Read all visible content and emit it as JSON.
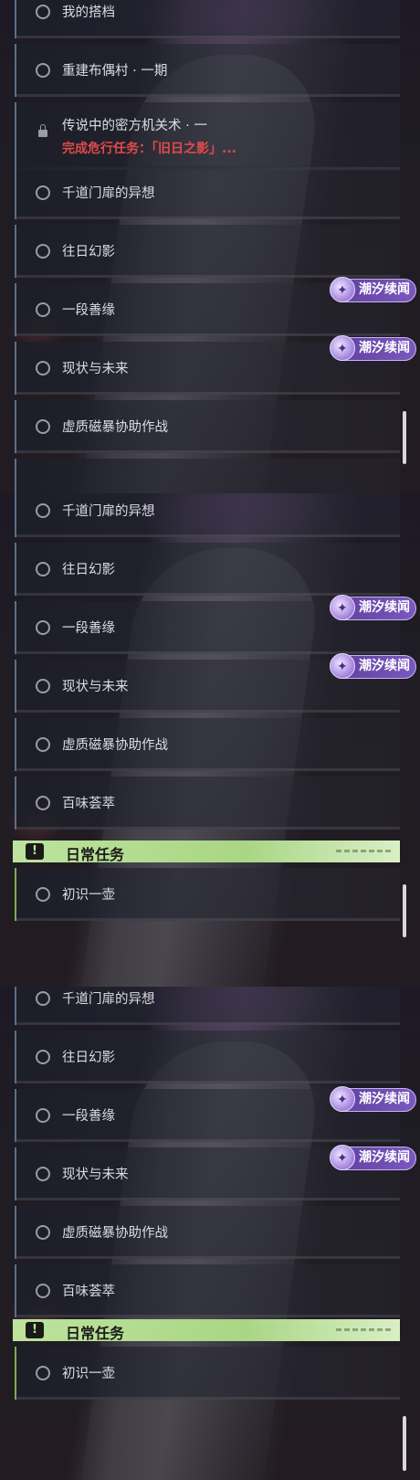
{
  "panel1": {
    "rows": [
      {
        "label": "我的搭档"
      },
      {
        "label": "重建布偶村 · 一期"
      },
      {
        "label": "传说中的密方机关术 · 一",
        "sublabel": "完成危行任务：「旧日之影」..."
      },
      {
        "label": "千道门扉的异想"
      },
      {
        "label": "往日幻影"
      },
      {
        "label": "一段善缘"
      },
      {
        "label": "现状与未来"
      },
      {
        "label": "虚质磁暴协助作战"
      }
    ],
    "badges": [
      "潮汐续闻",
      "潮汐续闻"
    ]
  },
  "panel2": {
    "rows": [
      {
        "label": "千道门扉的异想"
      },
      {
        "label": "往日幻影"
      },
      {
        "label": "一段善缘"
      },
      {
        "label": "现状与未来"
      },
      {
        "label": "虚质磁暴协助作战"
      },
      {
        "label": "百味荟萃"
      }
    ],
    "badges": [
      "潮汐续闻",
      "潮汐续闻"
    ],
    "section_title": "日常任务",
    "section_icon": "!",
    "daily_rows": [
      {
        "label": "初识一壶"
      }
    ]
  },
  "panel3": {
    "rows": [
      {
        "label": "千道门扉的异想"
      },
      {
        "label": "往日幻影"
      },
      {
        "label": "一段善缘"
      },
      {
        "label": "现状与未来"
      },
      {
        "label": "虚质磁暴协助作战"
      },
      {
        "label": "百味荟萃"
      }
    ],
    "badges": [
      "潮汐续闻",
      "潮汐续闻"
    ],
    "section_title": "日常任务",
    "section_icon": "!",
    "daily_rows": [
      {
        "label": "初识一壶"
      }
    ]
  },
  "colors": {
    "badge": "#6c4bb0",
    "daily_section": "#b5de91",
    "warning_text": "#e24a4a",
    "row_accent": "#5d6f86",
    "daily_accent": "#7cab55"
  },
  "icons": {
    "uncompleted": "circle-icon",
    "locked": "lock-icon",
    "badge": "tide-sparkle-icon",
    "section": "exclamation-icon"
  }
}
